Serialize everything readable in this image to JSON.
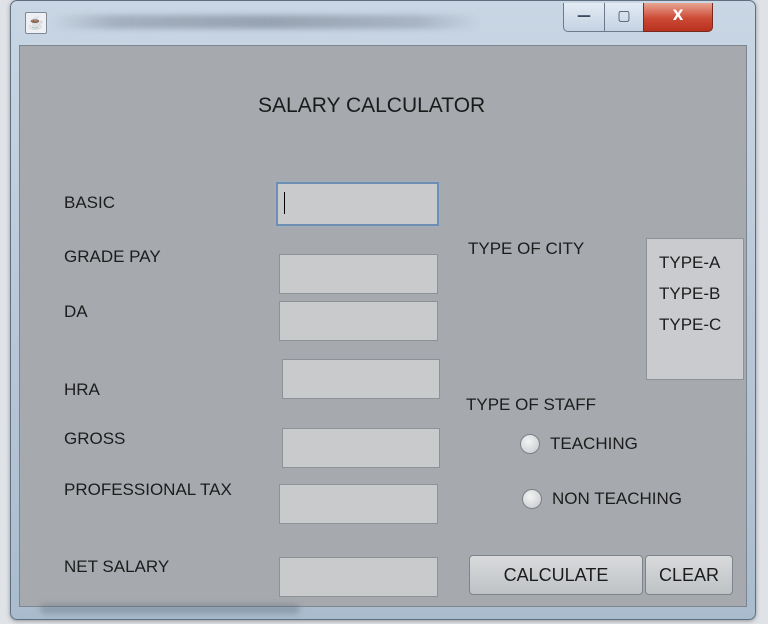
{
  "window": {
    "app_icon": "java-cup-icon",
    "controls": {
      "minimize": "—",
      "maximize": "▢",
      "close": "X"
    }
  },
  "heading": "SALARY CALCULATOR",
  "fields": [
    {
      "label": "BASIC",
      "value": ""
    },
    {
      "label": "GRADE PAY",
      "value": ""
    },
    {
      "label": "DA",
      "value": ""
    },
    {
      "label": "HRA",
      "value": ""
    },
    {
      "label": "GROSS",
      "value": ""
    },
    {
      "label": "PROFESSIONAL TAX",
      "value": ""
    },
    {
      "label": "NET SALARY",
      "value": ""
    }
  ],
  "city": {
    "label": "TYPE OF CITY",
    "options": [
      "TYPE-A",
      "TYPE-B",
      "TYPE-C"
    ]
  },
  "staff": {
    "label": "TYPE OF STAFF",
    "options": [
      {
        "label": "TEACHING",
        "selected": false
      },
      {
        "label": "NON TEACHING",
        "selected": false
      }
    ]
  },
  "buttons": {
    "calculate": "CALCULATE",
    "clear": "CLEAR"
  }
}
